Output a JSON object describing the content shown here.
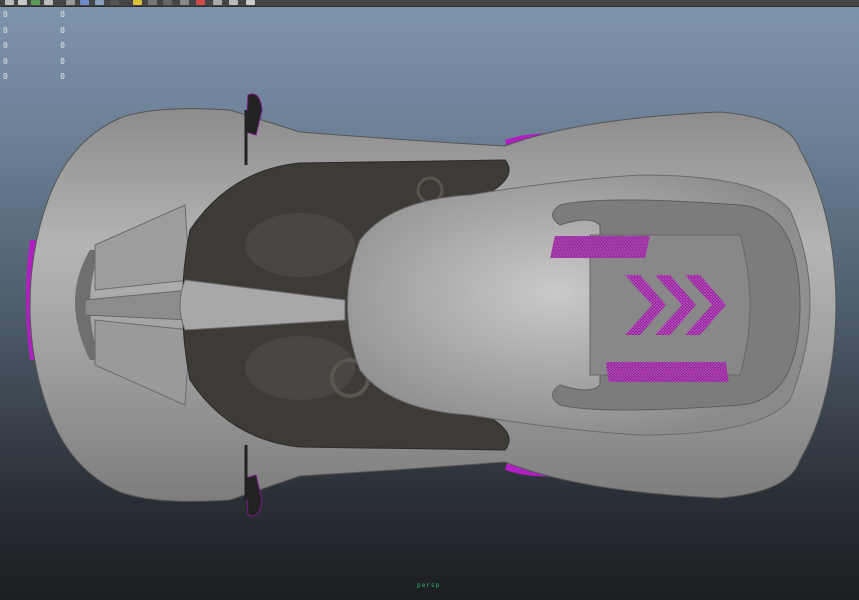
{
  "toolbar": {
    "icons": [
      "new-scene-icon",
      "open-scene-icon",
      "save-scene-icon",
      "snap-grid-icon",
      "select-tool-icon",
      "move-tool-icon",
      "rotate-tool-icon",
      "scale-tool-icon",
      "render-icon",
      "ipr-render-icon",
      "render-settings-icon",
      "display-icon",
      "camera-icon",
      "wireframe-icon",
      "lighting-icon",
      "isolate-icon"
    ]
  },
  "hud": {
    "rows": [
      {
        "count": "0",
        "selected": "0"
      },
      {
        "count": "0",
        "selected": "0"
      },
      {
        "count": "0",
        "selected": "0"
      },
      {
        "count": "0",
        "selected": "0"
      },
      {
        "count": "0",
        "selected": "0"
      }
    ]
  },
  "viewport": {
    "camera_label": "persp"
  },
  "colors": {
    "body": "#9a9a9a",
    "accent": "#c020d0",
    "cockpit": "#3f3b36"
  }
}
